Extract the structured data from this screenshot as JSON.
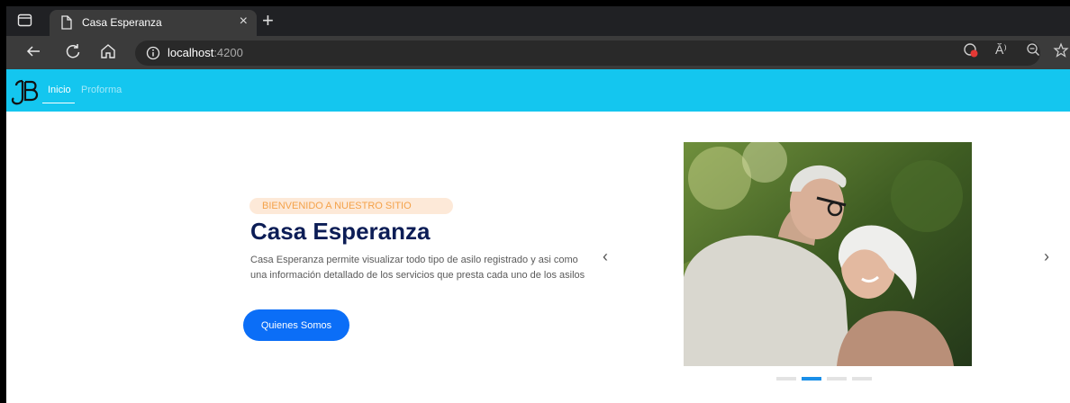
{
  "browser": {
    "tab": {
      "title": "Casa Esperanza",
      "close_glyph": "×"
    },
    "new_tab_glyph": "+",
    "url": {
      "host": "localhost",
      "port": ":4200"
    },
    "reader_label": "Ă⁾"
  },
  "navbar": {
    "items": [
      {
        "label": "Inicio",
        "active": true
      },
      {
        "label": "Proforma",
        "active": false
      }
    ]
  },
  "hero": {
    "badge": "BIENVENIDO A NUESTRO SITIO",
    "title": "Casa Esperanza",
    "description": "Casa Esperanza permite visualizar todo tipo de asilo registrado y asi como una información detallado de los servicios que presta cada uno de los asilos",
    "cta_label": "Quienes Somos"
  },
  "carousel": {
    "prev_glyph": "‹",
    "next_glyph": "›",
    "slide_count": 4,
    "active_index": 1
  },
  "colors": {
    "navbar": "#14c6ef",
    "title": "#0c1d56",
    "cta": "#0b6ef7",
    "badge_bg": "#fde9d8",
    "badge_text": "#f4a24a",
    "indicator_active": "#1a8fe8"
  },
  "icons": [
    "tab-actions-icon",
    "page-icon",
    "back-arrow-icon",
    "refresh-icon",
    "home-icon",
    "info-icon",
    "extension-icon",
    "read-aloud-icon",
    "zoom-icon",
    "favorite-star-icon",
    "jb-logo",
    "carousel-prev-icon",
    "carousel-next-icon"
  ]
}
